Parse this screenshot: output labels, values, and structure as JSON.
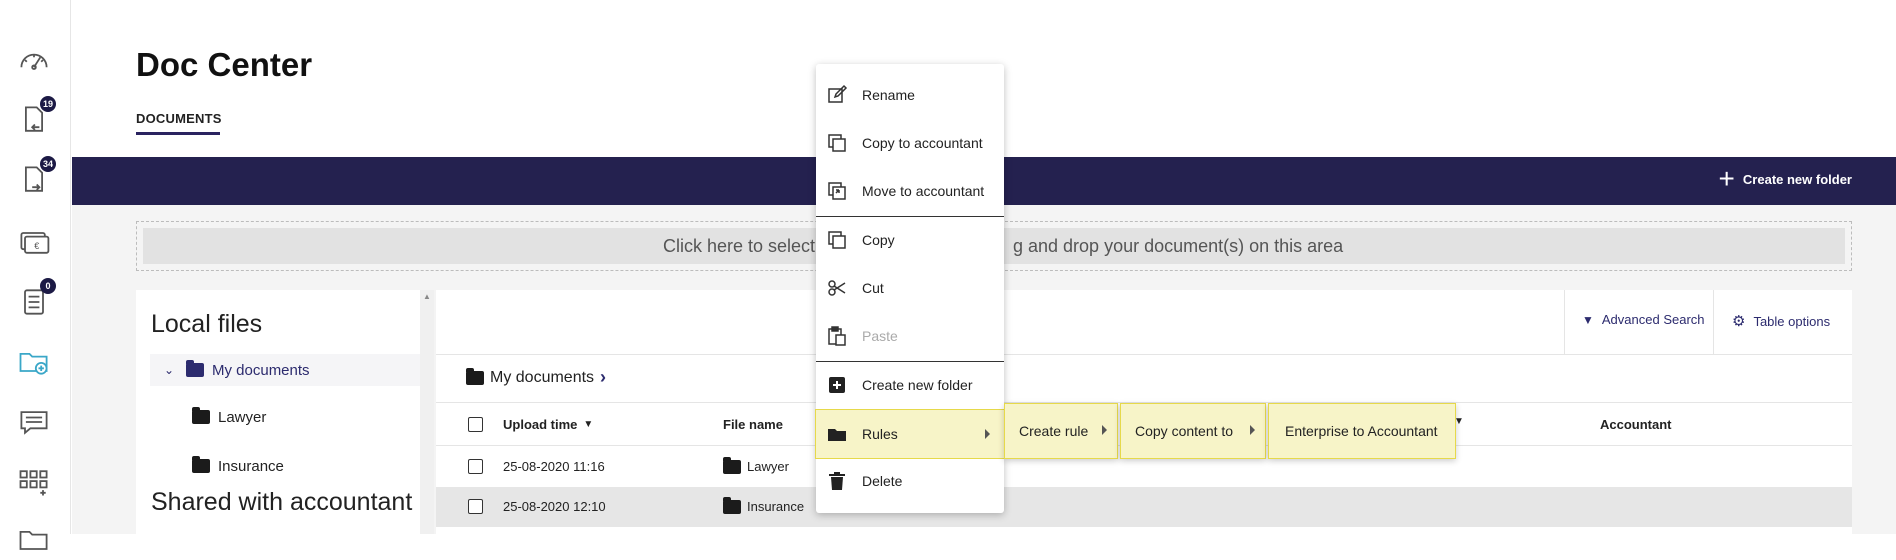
{
  "sidebar": {
    "icons": [
      {
        "name": "dashboard-gauge-icon"
      },
      {
        "name": "incoming-documents-icon",
        "badge": "19"
      },
      {
        "name": "outgoing-documents-icon",
        "badge": "34"
      },
      {
        "name": "payments-euro-icon"
      },
      {
        "name": "tasks-list-icon",
        "badge": "0"
      },
      {
        "name": "doc-center-folder-icon"
      },
      {
        "name": "messages-icon"
      },
      {
        "name": "apps-grid-icon"
      },
      {
        "name": "folder-icon"
      }
    ]
  },
  "header": {
    "title": "Doc Center",
    "tab": "DOCUMENTS"
  },
  "topbar": {
    "create_folder_label": "Create new folder"
  },
  "dropzone": {
    "text_left": "Click here to select",
    "text_right": "g and drop your document(s) on this area"
  },
  "left_panel": {
    "local_heading": "Local files",
    "tree": [
      {
        "label": "My documents",
        "selected": true
      },
      {
        "label": "Lawyer"
      },
      {
        "label": "Insurance"
      }
    ],
    "shared_heading": "Shared with accountant"
  },
  "toolbar": {
    "advanced_search": "Advanced Search",
    "table_options": "Table options"
  },
  "breadcrumb": {
    "current": "My documents"
  },
  "table": {
    "headers": {
      "upload_time": "Upload time",
      "file_name": "File name",
      "accountant": "Accountant"
    },
    "rows": [
      {
        "upload_time": "25-08-2020 11:16",
        "file_name": "Lawyer"
      },
      {
        "upload_time": "25-08-2020 12:10",
        "file_name": "Insurance"
      }
    ]
  },
  "context_menu": {
    "items": {
      "rename": "Rename",
      "copy_to_accountant": "Copy to accountant",
      "move_to_accountant": "Move to accountant",
      "copy": "Copy",
      "cut": "Cut",
      "paste": "Paste",
      "create_new_folder": "Create new folder",
      "rules": "Rules",
      "delete": "Delete"
    },
    "submenus": {
      "create_rule": "Create rule",
      "copy_content_to": "Copy content to",
      "enterprise_to_accountant": "Enterprise to Accountant"
    }
  },
  "colors": {
    "navy": "#24214f",
    "accent": "#2c2b6e",
    "highlight": "#f7f4c8",
    "highlight_border": "#e6d94a"
  }
}
